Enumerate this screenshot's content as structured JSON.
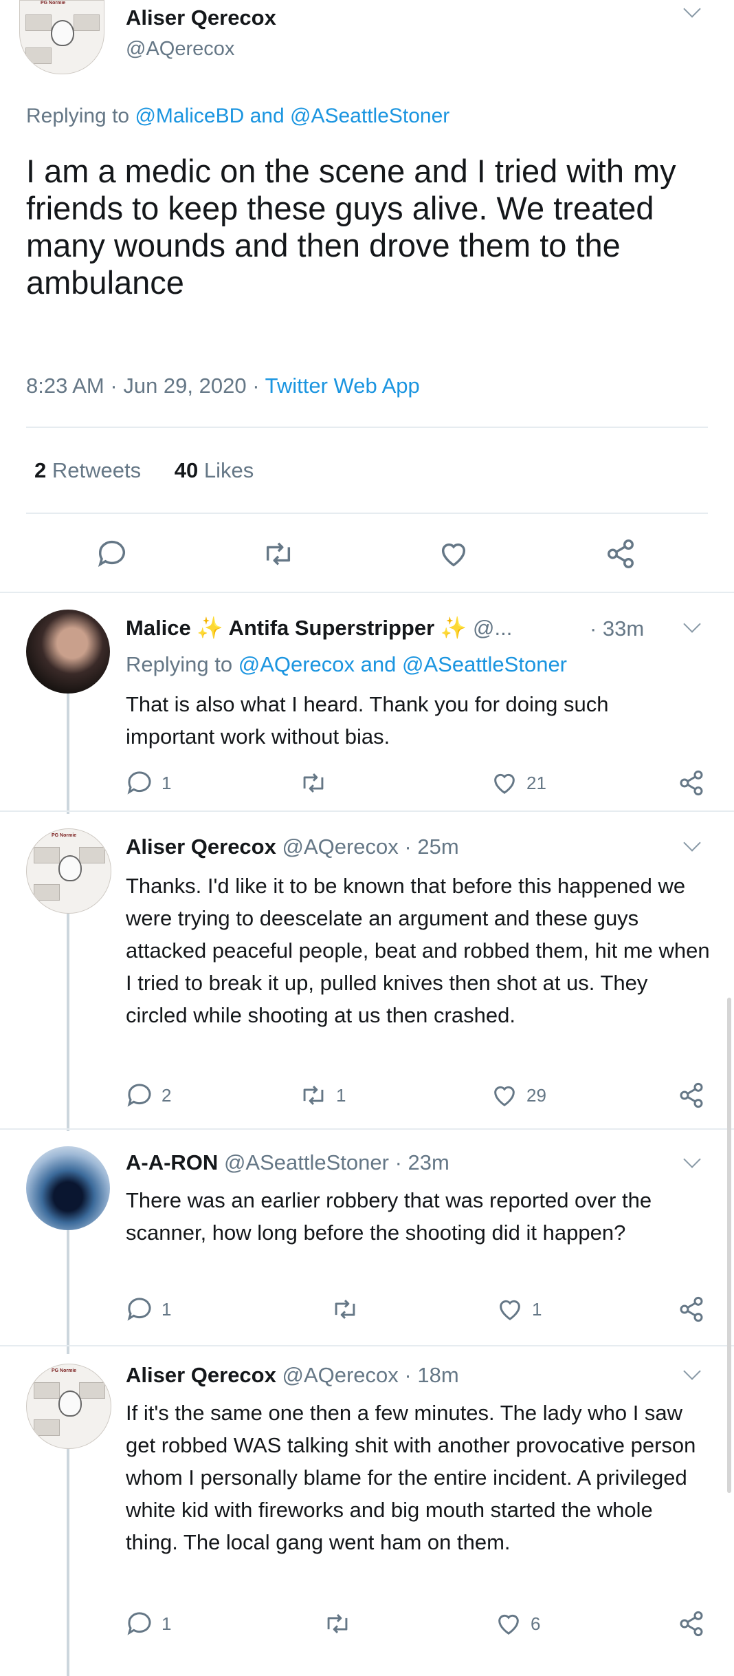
{
  "main_tweet": {
    "name": "Aliser Qerecox",
    "handle": "@AQerecox",
    "replying_prefix": "Replying to",
    "reply_to_1": "@MaliceBD",
    "reply_and": "and",
    "reply_to_2": "@ASeattleStoner",
    "text": "I am a medic on the scene and I tried with my friends to keep these guys alive. We treated many wounds and then drove them to the ambulance",
    "time": "8:23 AM",
    "date": "Jun 29, 2020",
    "sep": "·",
    "source": "Twitter Web App",
    "retweets_count": "2",
    "retweets_label": "Retweets",
    "likes_count": "40",
    "likes_label": "Likes",
    "avatar_tag": "PG Normie"
  },
  "replies": [
    {
      "name": "Malice ✨ Antifa Superstripper ✨",
      "handle": "@...",
      "time": "· 33m",
      "reply_prefix": "Replying to",
      "reply_1": "@AQerecox",
      "reply_and": "and",
      "reply_2": "@ASeattleStoner",
      "text": "That is also what I heard. Thank you for doing such important work without bias.",
      "replies": "1",
      "retweets": "",
      "likes": "21"
    },
    {
      "name": "Aliser Qerecox",
      "handle": "@AQerecox",
      "time": "· 25m",
      "text": "Thanks. I'd like it to be known that before this happened we were trying to deescelate an argument and these guys attacked peaceful people, beat and robbed them, hit me when I tried to break it up, pulled knives then shot at us. They circled while shooting at us then crashed.",
      "replies": "2",
      "retweets": "1",
      "likes": "29",
      "avatar_tag": "PG Normie"
    },
    {
      "name": "A-A-RON",
      "handle": "@ASeattleStoner",
      "time": "· 23m",
      "text": "There was an earlier robbery that was reported over the scanner, how long before the shooting did it happen?",
      "replies": "1",
      "retweets": "",
      "likes": "1"
    },
    {
      "name": "Aliser Qerecox",
      "handle": "@AQerecox",
      "time": "· 18m",
      "text": "If it's the same one then a few minutes. The lady who I saw get robbed WAS talking shit with another provocative person whom I personally blame for the entire incident. A privileged white kid with fireworks and big mouth started the whole thing. The local gang went ham on them.",
      "replies": "1",
      "retweets": "",
      "likes": "6",
      "avatar_tag": "PG Normie"
    }
  ],
  "icons": {
    "reply": "reply-icon",
    "retweet": "retweet-icon",
    "like": "heart-icon",
    "share": "share-icon",
    "more": "chevron-down-icon"
  },
  "colors": {
    "link": "#1b95e0",
    "secondary": "#657786",
    "divider": "#e6ecf0"
  }
}
